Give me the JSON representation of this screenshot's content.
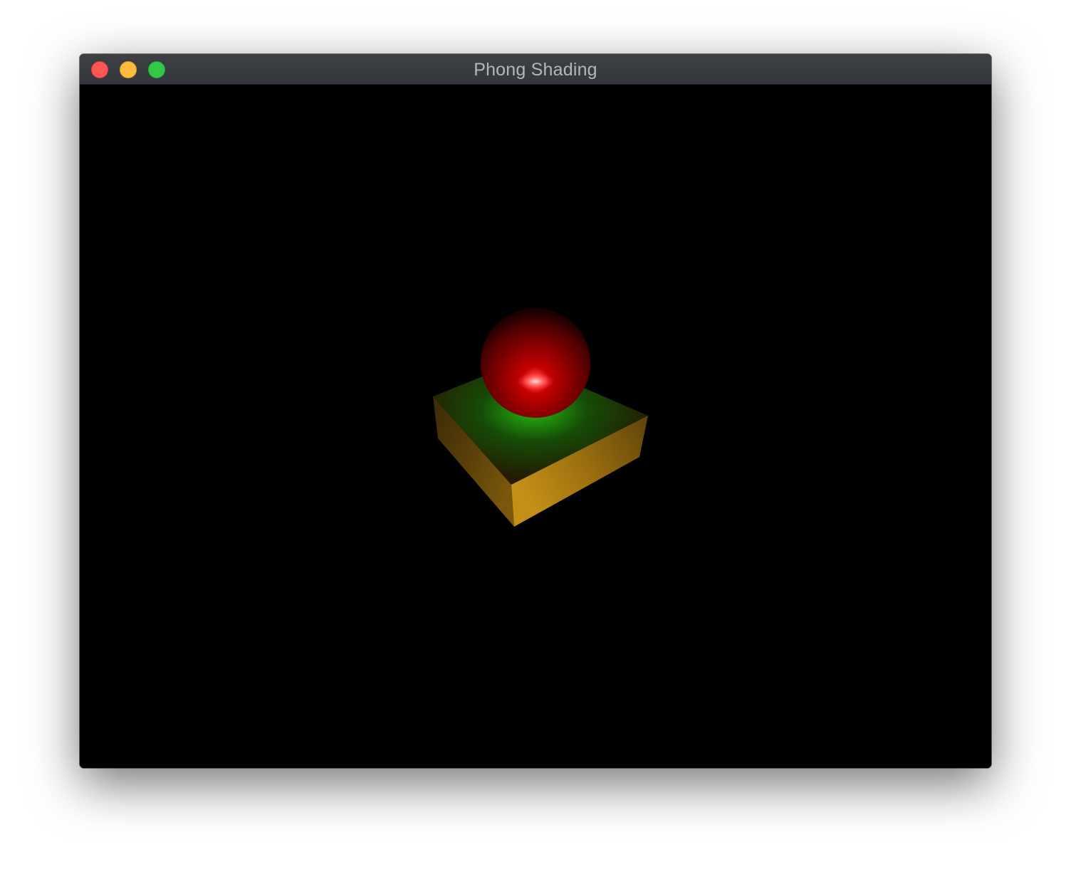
{
  "window": {
    "title": "Phong Shading",
    "buttons": {
      "close_color": "#fc5753",
      "minimize_color": "#fdbc40",
      "zoom_color": "#34c84a"
    }
  },
  "scene": {
    "background": "#000000",
    "objects": [
      {
        "name": "sphere",
        "color": "#cc0000",
        "material": "shiny"
      },
      {
        "name": "cube",
        "color": "#d4a020"
      },
      {
        "name": "light-spot",
        "color": "#22aa11"
      }
    ]
  }
}
